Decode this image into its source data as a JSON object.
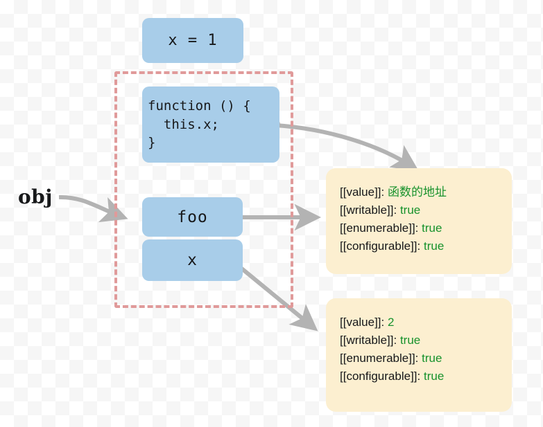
{
  "diagram": {
    "title": "JavaScript object property descriptor diagram",
    "obj_label": "obj",
    "colors": {
      "node_fill": "#a8cde9",
      "card_fill": "#fcefd0",
      "frame_dashed": "#e09a9a",
      "value_green": "#17922c",
      "connector_gray": "#b3b3b3",
      "text_dark": "#17181a"
    },
    "nodes": {
      "x_assignment": "x = 1",
      "function_body": "function () {\n  this.x;\n}",
      "property_foo": "foo",
      "property_x": "x"
    },
    "cards": [
      {
        "id": "foo-descriptor",
        "lines": [
          {
            "key": "[[value]]:",
            "value": "函数的地址"
          },
          {
            "key": "[[writable]]:",
            "value": "true"
          },
          {
            "key": "[[enumerable]]:",
            "value": "true"
          },
          {
            "key": "[[configurable]]:",
            "value": "true"
          }
        ]
      },
      {
        "id": "x-descriptor",
        "lines": [
          {
            "key": "[[value]]:",
            "value": "2"
          },
          {
            "key": "[[writable]]:",
            "value": "true"
          },
          {
            "key": "[[enumerable]]:",
            "value": "true"
          },
          {
            "key": "[[configurable]]:",
            "value": "true"
          }
        ]
      }
    ]
  }
}
